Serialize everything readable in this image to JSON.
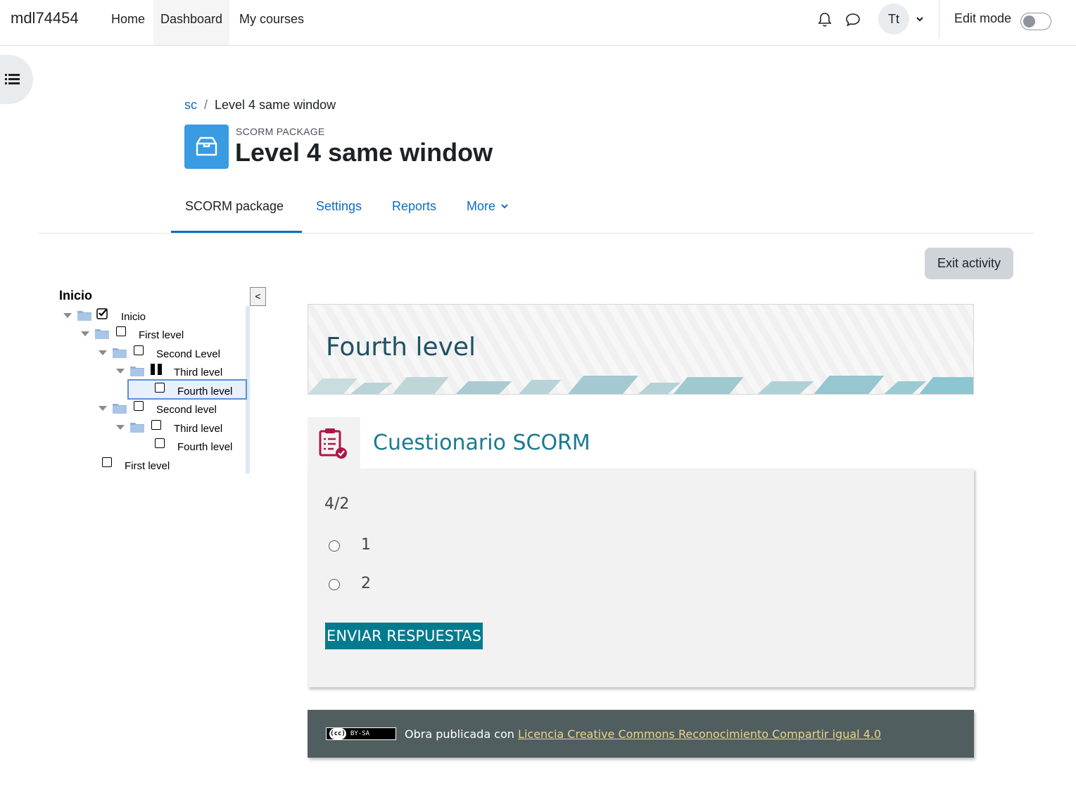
{
  "navbar": {
    "site_name": "mdl74454",
    "links": [
      {
        "label": "Home"
      },
      {
        "label": "Dashboard"
      },
      {
        "label": "My courses"
      }
    ],
    "avatar_initials": "Tt",
    "edit_mode_label": "Edit mode",
    "edit_mode_on": false
  },
  "breadcrumb": {
    "course": "sc",
    "separator": "/",
    "current": "Level 4 same window"
  },
  "header": {
    "activity_type": "SCORM PACKAGE",
    "title": "Level 4 same window",
    "icon_color": "#399be2"
  },
  "secondary_nav": {
    "tabs": [
      {
        "label": "SCORM package",
        "active": true
      },
      {
        "label": "Settings"
      },
      {
        "label": "Reports"
      },
      {
        "label": "More"
      }
    ]
  },
  "exit_activity_label": "Exit activity",
  "toc": {
    "title": "Inicio",
    "collapse_label": "<",
    "items": [
      {
        "label": "Inicio",
        "status": "completed"
      },
      {
        "label": "First level",
        "status": "not-attempted"
      },
      {
        "label": "Second Level",
        "status": "not-attempted"
      },
      {
        "label": "Third level",
        "status": "suspended"
      },
      {
        "label": "Fourth level",
        "status": "not-attempted",
        "selected": true
      },
      {
        "label": "Second level",
        "status": "not-attempted"
      },
      {
        "label": "Third level",
        "status": "not-attempted"
      },
      {
        "label": "Fourth level",
        "status": "not-attempted"
      },
      {
        "label": "First level",
        "status": "not-attempted"
      }
    ]
  },
  "content": {
    "banner_title": "Fourth level",
    "quiz_title": "Cuestionario SCORM",
    "question": "4/2",
    "options": [
      {
        "label": "1"
      },
      {
        "label": "2"
      }
    ],
    "submit_label": "ENVIAR RESPUESTAS",
    "footer": {
      "badge": "BY-SA",
      "text": "Obra publicada con",
      "link": "Licencia Creative Commons Reconocimiento Compartir igual 4.0"
    }
  },
  "colors": {
    "link": "#0f6cbf",
    "submit": "#037b8e",
    "footer_bg": "#505e60",
    "footer_link": "#e9d48a"
  }
}
